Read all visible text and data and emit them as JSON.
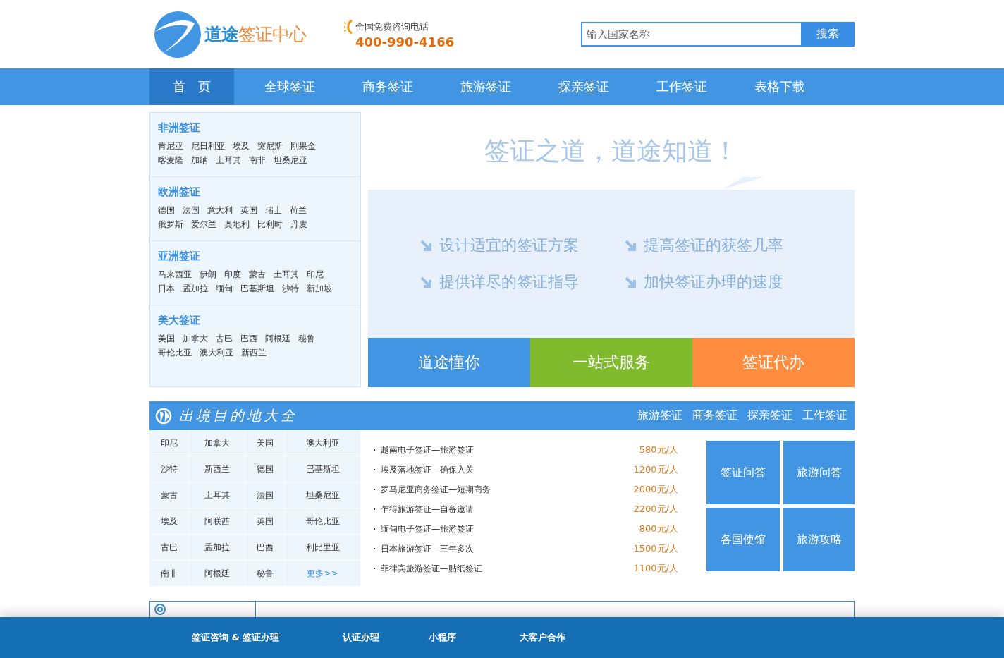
{
  "header": {
    "logo": {
      "brand": "道途",
      "suffix": "签证中心"
    },
    "hotline": {
      "label": "全国免费咨询电话",
      "number": "400-990-4166"
    },
    "search": {
      "placeholder": "输入国家名称",
      "button": "搜索"
    }
  },
  "nav": [
    {
      "label": "首　页",
      "selected": true
    },
    {
      "label": "全球签证",
      "selected": false
    },
    {
      "label": "商务签证",
      "selected": false
    },
    {
      "label": "旅游签证",
      "selected": false
    },
    {
      "label": "探亲签证",
      "selected": false
    },
    {
      "label": "工作签证",
      "selected": false
    },
    {
      "label": "表格下载",
      "selected": false
    }
  ],
  "regions": [
    {
      "title": "非洲签证",
      "lines": [
        [
          "肯尼亚",
          "尼日利亚",
          "埃及",
          "突尼斯",
          "刚果金"
        ],
        [
          "喀麦隆",
          "加纳",
          "土耳其",
          "南非",
          "坦桑尼亚"
        ]
      ]
    },
    {
      "title": "欧洲签证",
      "lines": [
        [
          "德国",
          "法国",
          "意大利",
          "英国",
          "瑞士",
          "荷兰"
        ],
        [
          "俄罗斯",
          "爱尔兰",
          "奥地利",
          "比利时",
          "丹麦"
        ]
      ]
    },
    {
      "title": "亚洲签证",
      "lines": [
        [
          "马来西亚",
          "伊朗",
          "印度",
          "蒙古",
          "土耳其",
          "印尼"
        ],
        [
          "日本",
          "孟加拉",
          "缅甸",
          "巴基斯坦",
          "沙特",
          "新加坡"
        ]
      ]
    },
    {
      "title": "美大签证",
      "lines": [
        [
          "美国",
          "加拿大",
          "古巴",
          "巴西",
          "阿根廷",
          "秘鲁"
        ],
        [
          "哥伦比亚",
          "澳大利亚",
          "新西兰"
        ]
      ]
    }
  ],
  "hero": {
    "title": "签证之道，道途知道！",
    "slogans": [
      "设计适宜的签证方案",
      "提高签证的获签几率",
      "提供详尽的签证指导",
      "加快签证办理的速度"
    ],
    "tiles": [
      {
        "label": "道途懂你",
        "color": "#4195e3"
      },
      {
        "label": "一站式服务",
        "color": "#80bb2d"
      },
      {
        "label": "签证代办",
        "color": "#fe8c3f"
      }
    ]
  },
  "destinations": {
    "title": "出境目的地大全",
    "links": [
      "旅游签证",
      "商务签证",
      "探亲签证",
      "工作签证"
    ],
    "grid": [
      [
        "印尼",
        "加拿大",
        "美国",
        "澳大利亚"
      ],
      [
        "沙特",
        "新西兰",
        "德国",
        "巴基斯坦"
      ],
      [
        "蒙古",
        "土耳其",
        "法国",
        "坦桑尼亚"
      ],
      [
        "埃及",
        "阿联酋",
        "英国",
        "哥伦比亚"
      ],
      [
        "古巴",
        "孟加拉",
        "巴西",
        "利比里亚"
      ],
      [
        "南非",
        "阿根廷",
        "秘鲁"
      ]
    ],
    "more": "更多>>",
    "products": [
      {
        "name": "越南电子签证—旅游签证",
        "price": "580元/人"
      },
      {
        "name": "埃及落地签证—确保入关",
        "price": "1200元/人"
      },
      {
        "name": "罗马尼亚商务签证—短期商务",
        "price": "2000元/人"
      },
      {
        "name": "乍得旅游签证—自备邀请",
        "price": "2200元/人"
      },
      {
        "name": "缅甸电子签证—旅游签证",
        "price": "800元/人"
      },
      {
        "name": "日本旅游签证—三年多次",
        "price": "1500元/人"
      },
      {
        "name": "菲律宾旅游签证—贴纸签证",
        "price": "1100元/人"
      }
    ],
    "quick_links": [
      "签证问答",
      "旅游问答",
      "各国使馆",
      "旅游攻略"
    ]
  },
  "footer": {
    "links": [
      "签证咨询 & 签证办理",
      "认证办理",
      "小程序",
      "大客户合作"
    ]
  }
}
